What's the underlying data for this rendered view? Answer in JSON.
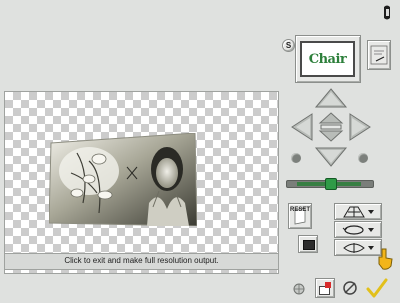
{
  "status": {
    "text": "Click to exit and make full resolution output."
  },
  "preview": {
    "thumbnail_text": "Chair",
    "s_button": "S"
  },
  "icons": {
    "help": "help-icon",
    "print": "print-icon",
    "nudge_up": "arrow-up-icon",
    "nudge_down": "arrow-down-icon",
    "nudge_left": "arrow-left-icon",
    "nudge_right": "arrow-right-icon",
    "center": "center-icon",
    "reset": "reset-icon",
    "perspective": "perspective-icon",
    "rotate": "rotate-icon",
    "flip": "flip-icon",
    "ok": "checkmark-icon",
    "no": "no-icon"
  },
  "labels": {
    "reset": "RESET"
  },
  "colors": {
    "panel": "#dfe1df",
    "accent_green": "#2c7f3a",
    "pointer": "#f2b51a",
    "check": "#e2c01a"
  }
}
